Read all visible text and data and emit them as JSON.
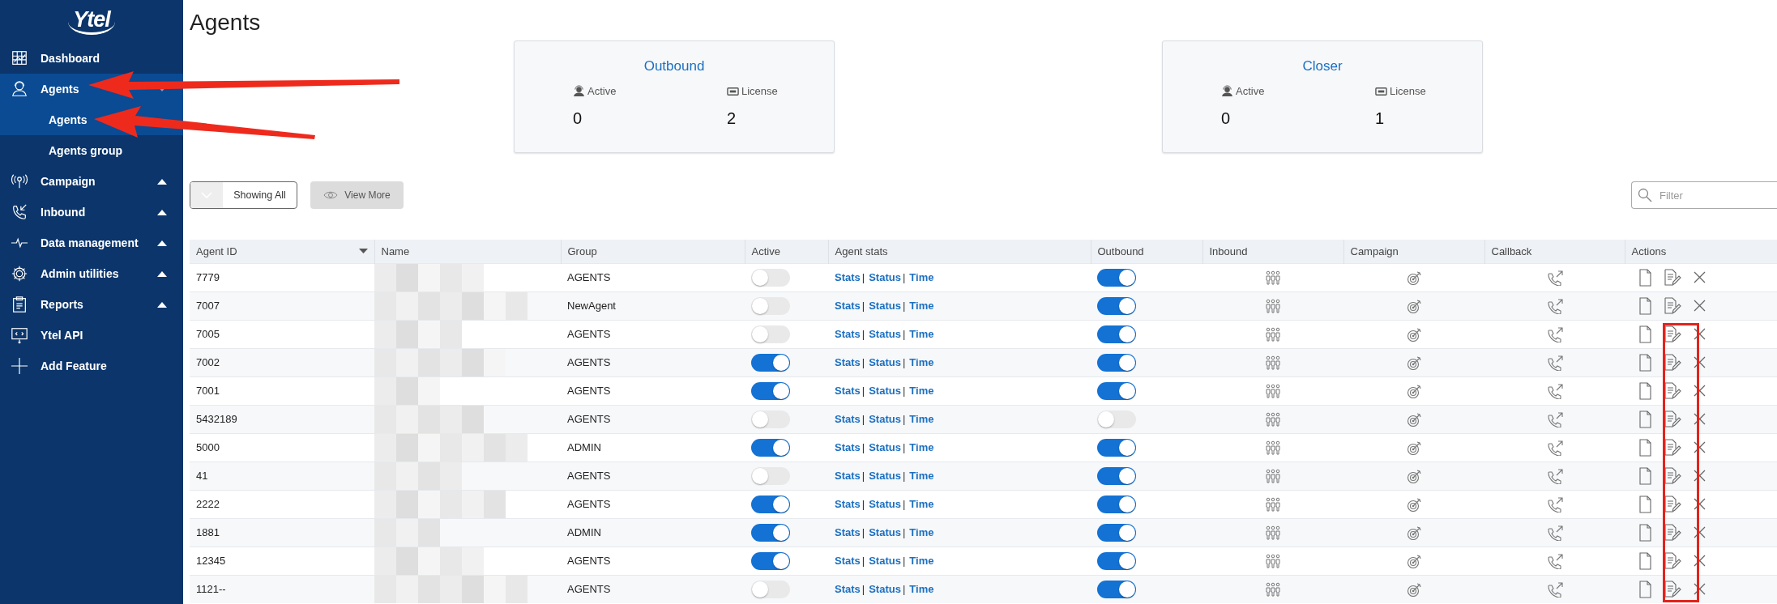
{
  "sidebar": {
    "logo": "Ytel",
    "items": [
      {
        "label": "Dashboard",
        "selected": false
      },
      {
        "label": "Agents",
        "selected": true,
        "expanded": true,
        "children": [
          {
            "label": "Agents",
            "selected": true
          },
          {
            "label": "Agents group",
            "selected": false
          }
        ]
      },
      {
        "label": "Campaign",
        "selected": false,
        "expanded": false
      },
      {
        "label": "Inbound",
        "selected": false,
        "expanded": false
      },
      {
        "label": "Data management",
        "selected": false,
        "expanded": false
      },
      {
        "label": "Admin utilities",
        "selected": false,
        "expanded": false
      },
      {
        "label": "Reports",
        "selected": false,
        "expanded": false
      },
      {
        "label": "Ytel API",
        "selected": false
      },
      {
        "label": "Add Feature",
        "selected": false
      }
    ]
  },
  "page_title": "Agents",
  "stat_cards": [
    {
      "title": "Outbound",
      "active_label": "Active",
      "active_value": "0",
      "license_label": "License",
      "license_value": "2"
    },
    {
      "title": "Closer",
      "active_label": "Active",
      "active_value": "0",
      "license_label": "License",
      "license_value": "1"
    }
  ],
  "toolbar": {
    "showing_button": "Showing All",
    "view_more_button": "View More",
    "filter": {
      "placeholder": "Filter"
    }
  },
  "table": {
    "columns": [
      "Agent ID",
      "Name",
      "Group",
      "Active",
      "Agent stats",
      "Outbound",
      "Inbound",
      "Campaign",
      "Callback",
      "Actions"
    ],
    "rows": [
      {
        "agent_id": "7779",
        "group": "AGENTS",
        "active": false,
        "stats_links": [
          {
            "label": "Stats",
            "sep": "|"
          },
          {
            "label": "Status",
            "sep": "|"
          },
          {
            "label": "Time"
          }
        ],
        "outbound": true
      },
      {
        "agent_id": "7007",
        "group": "NewAgent",
        "active": false,
        "stats_links": [
          {
            "label": "Stats",
            "sep": "|"
          },
          {
            "label": "Status",
            "sep": "|"
          },
          {
            "label": "Time"
          }
        ],
        "outbound": true
      },
      {
        "agent_id": "7005",
        "group": "AGENTS",
        "active": false,
        "stats_links": [
          {
            "label": "Stats",
            "sep": "|"
          },
          {
            "label": "Status",
            "sep": "|"
          },
          {
            "label": "Time"
          }
        ],
        "outbound": true
      },
      {
        "agent_id": "7002",
        "group": "AGENTS",
        "active": true,
        "stats_links": [
          {
            "label": "Stats",
            "sep": "|"
          },
          {
            "label": "Status",
            "sep": "|"
          },
          {
            "label": "Time"
          }
        ],
        "outbound": true
      },
      {
        "agent_id": "7001",
        "group": "AGENTS",
        "active": true,
        "stats_links": [
          {
            "label": "Stats",
            "sep": "|"
          },
          {
            "label": "Status",
            "sep": "|"
          },
          {
            "label": "Time"
          }
        ],
        "outbound": true
      },
      {
        "agent_id": "5432189",
        "group": "AGENTS",
        "active": false,
        "stats_links": [
          {
            "label": "Stats",
            "sep": "|"
          },
          {
            "label": "Status",
            "sep": "|"
          },
          {
            "label": "Time"
          }
        ],
        "outbound": false
      },
      {
        "agent_id": "5000",
        "group": "ADMIN",
        "active": true,
        "stats_links": [
          {
            "label": "Stats",
            "sep": "|"
          },
          {
            "label": "Status",
            "sep": "|"
          },
          {
            "label": "Time"
          }
        ],
        "outbound": true
      },
      {
        "agent_id": "41",
        "group": "AGENTS",
        "active": false,
        "stats_links": [
          {
            "label": "Stats",
            "sep": "|"
          },
          {
            "label": "Status",
            "sep": "|"
          },
          {
            "label": "Time"
          }
        ],
        "outbound": true
      },
      {
        "agent_id": "2222",
        "group": "AGENTS",
        "active": true,
        "stats_links": [
          {
            "label": "Stats",
            "sep": "|"
          },
          {
            "label": "Status",
            "sep": "|"
          },
          {
            "label": "Time"
          }
        ],
        "outbound": true
      },
      {
        "agent_id": "1881",
        "group": "ADMIN",
        "active": true,
        "stats_links": [
          {
            "label": "Stats",
            "sep": "|"
          },
          {
            "label": "Status",
            "sep": "|"
          },
          {
            "label": "Time"
          }
        ],
        "outbound": true
      },
      {
        "agent_id": "12345",
        "group": "AGENTS",
        "active": true,
        "stats_links": [
          {
            "label": "Stats",
            "sep": "|"
          },
          {
            "label": "Status",
            "sep": "|"
          },
          {
            "label": "Time"
          }
        ],
        "outbound": true
      },
      {
        "agent_id": "1121--",
        "group": "AGENTS",
        "active": false,
        "stats_links": [
          {
            "label": "Stats",
            "sep": "|"
          },
          {
            "label": "Status",
            "sep": "|"
          },
          {
            "label": "Time"
          }
        ],
        "outbound": true
      }
    ]
  }
}
